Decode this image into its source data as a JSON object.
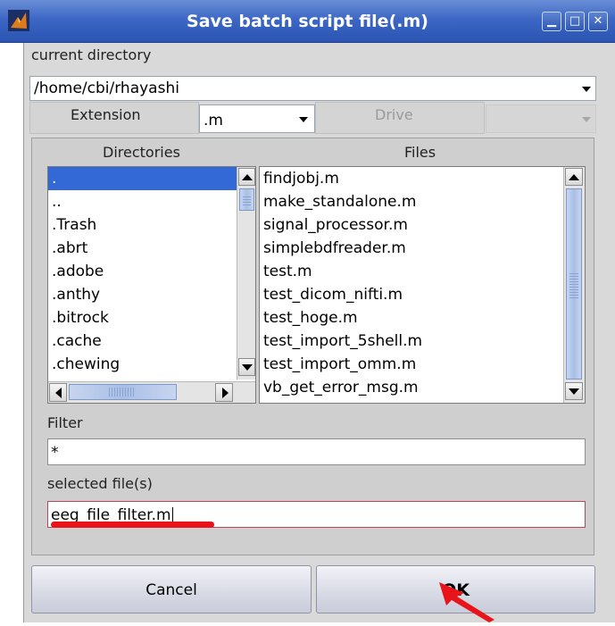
{
  "window": {
    "title": "Save batch script file(.m)"
  },
  "titlebar": {
    "minimize_glyph": "▁",
    "maximize_glyph": "□",
    "close_glyph": "✕"
  },
  "current_directory": {
    "label": "current directory",
    "value": "/home/cbi/rhayashi"
  },
  "extension": {
    "label": "Extension",
    "value": ".m"
  },
  "drive": {
    "label": "Drive",
    "value": ""
  },
  "directories": {
    "label": "Directories",
    "items": [
      ".",
      "..",
      ".Trash",
      ".abrt",
      ".adobe",
      ".anthy",
      ".bitrock",
      ".cache",
      ".chewing"
    ],
    "selected_index": 0
  },
  "files": {
    "label": "Files",
    "items": [
      "findjobj.m",
      "make_standalone.m",
      "signal_processor.m",
      "simplebdfreader.m",
      "test.m",
      "test_dicom_nifti.m",
      "test_hoge.m",
      "test_import_5shell.m",
      "test_import_omm.m",
      "vb_get_error_msg.m"
    ]
  },
  "filter": {
    "label": "Filter",
    "value": "*"
  },
  "selected_files": {
    "label": "selected file(s)",
    "value": "eeg_file_filter.m"
  },
  "buttons": {
    "cancel": "Cancel",
    "ok": "OK"
  },
  "colors": {
    "titlebar": "#3c67c4",
    "selection": "#3369d6",
    "annotation_red": "#e8141a"
  },
  "icons": [
    "app-icon",
    "minimize-icon",
    "maximize-icon",
    "close-icon",
    "dropdown-arrow-icon",
    "scroll-up-icon",
    "scroll-down-icon",
    "scroll-left-icon",
    "scroll-right-icon",
    "annotation-arrow-icon"
  ]
}
